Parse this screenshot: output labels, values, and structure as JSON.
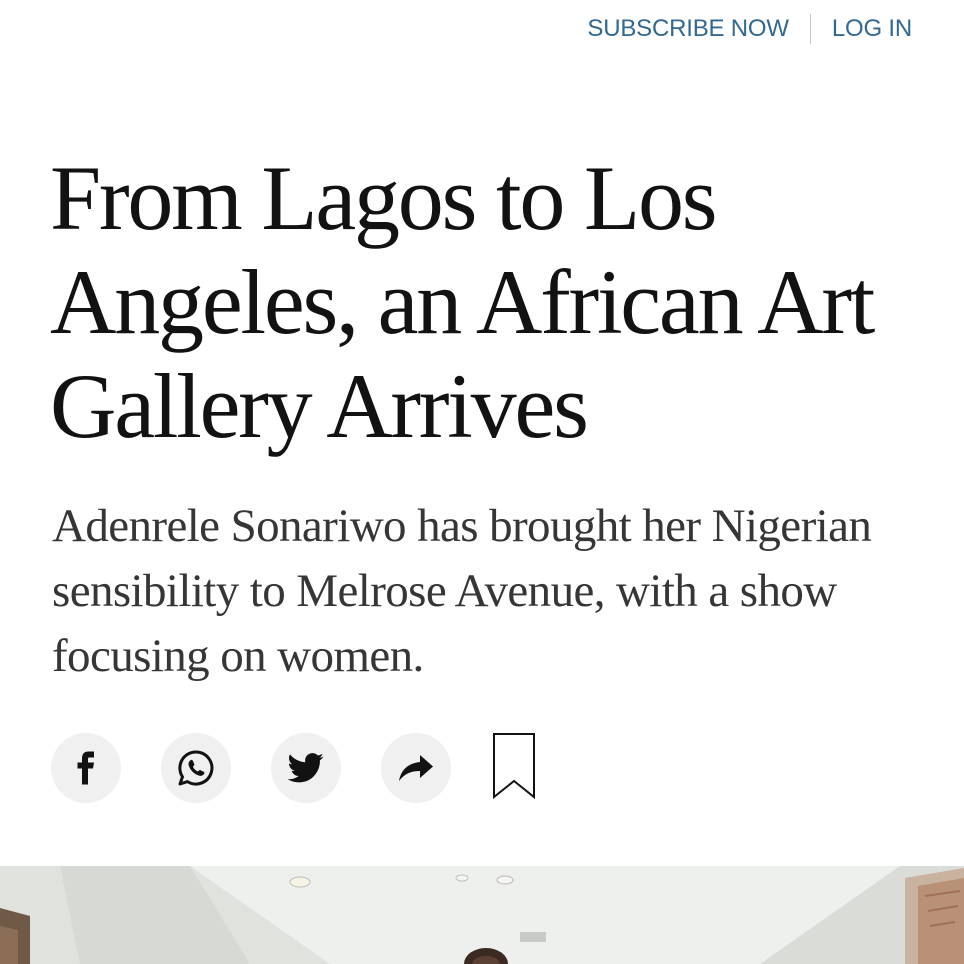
{
  "header": {
    "subscribe_label": "SUBSCRIBE NOW",
    "login_label": "LOG IN",
    "link_color": "#326891"
  },
  "article": {
    "headline": "From Lagos to Los Angeles, an African Art Gallery Arrives",
    "summary": "Adenrele Sonariwo has brought her Nigerian sensibility to Melrose Avenue, with a show focusing on women."
  },
  "share_tools": [
    {
      "name": "facebook",
      "icon": "facebook-icon"
    },
    {
      "name": "whatsapp",
      "icon": "whatsapp-icon"
    },
    {
      "name": "twitter",
      "icon": "twitter-icon"
    },
    {
      "name": "share",
      "icon": "share-arrow-icon"
    },
    {
      "name": "save",
      "icon": "bookmark-icon"
    }
  ],
  "colors": {
    "text": "#121212",
    "summary_text": "#363636",
    "share_button_bg": "#f0f0f0"
  }
}
